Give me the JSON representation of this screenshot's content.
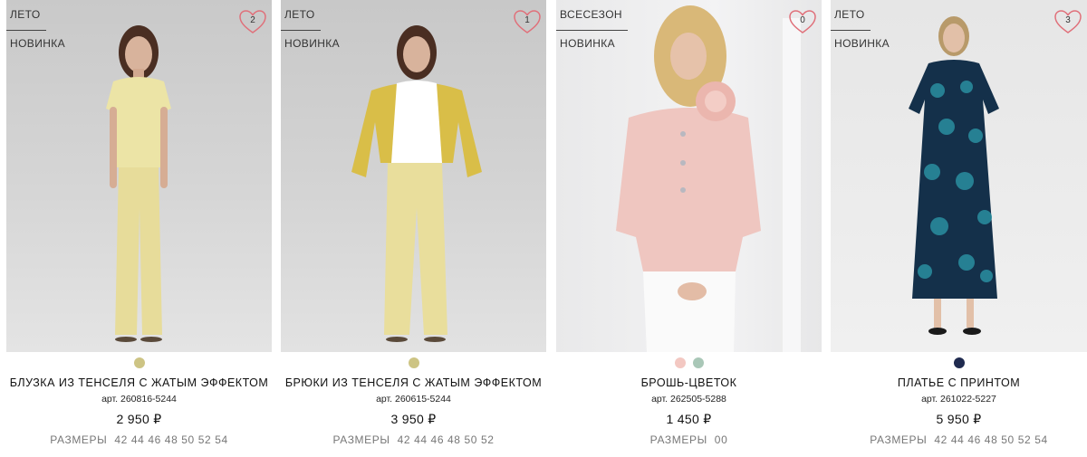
{
  "products": [
    {
      "tags": [
        "ЛЕТО",
        "НОВИНКА"
      ],
      "favorites": "2",
      "swatches": [
        "#cdc484"
      ],
      "title": "БЛУЗКА ИЗ ТЕНСЕЛЯ С ЖАТЫМ ЭФФЕКТОМ",
      "sku": "арт. 260816-5244",
      "price": "2 950 ₽",
      "sizes_label": "РАЗМЕРЫ",
      "sizes": "42 44 46 48 50 52 54"
    },
    {
      "tags": [
        "ЛЕТО",
        "НОВИНКА"
      ],
      "favorites": "1",
      "swatches": [
        "#cdc484"
      ],
      "title": "БРЮКИ ИЗ ТЕНСЕЛЯ С ЖАТЫМ ЭФФЕКТОМ",
      "sku": "арт. 260615-5244",
      "price": "3 950 ₽",
      "sizes_label": "РАЗМЕРЫ",
      "sizes": "42 44 46 48 50 52"
    },
    {
      "tags": [
        "ВСЕСЕЗОН",
        "НОВИНКА"
      ],
      "favorites": "0",
      "swatches": [
        "#f3c8c2",
        "#a9c7b7"
      ],
      "title": "БРОШЬ-ЦВЕТОК",
      "sku": "арт. 262505-5288",
      "price": "1 450 ₽",
      "sizes_label": "РАЗМЕРЫ",
      "sizes": "00"
    },
    {
      "tags": [
        "ЛЕТО",
        "НОВИНКА"
      ],
      "favorites": "3",
      "swatches": [
        "#1f2a4f"
      ],
      "title": "ПЛАТЬЕ С ПРИНТОМ",
      "sku": "арт. 261022-5227",
      "price": "5 950 ₽",
      "sizes_label": "РАЗМЕРЫ",
      "sizes": "42 44 46 48 50 52 54"
    }
  ],
  "colors": {
    "heart": "#e0707a",
    "tag_text": "#333333",
    "sizes_text": "#777777"
  },
  "icons": {
    "favorite": "heart-outline-icon"
  }
}
